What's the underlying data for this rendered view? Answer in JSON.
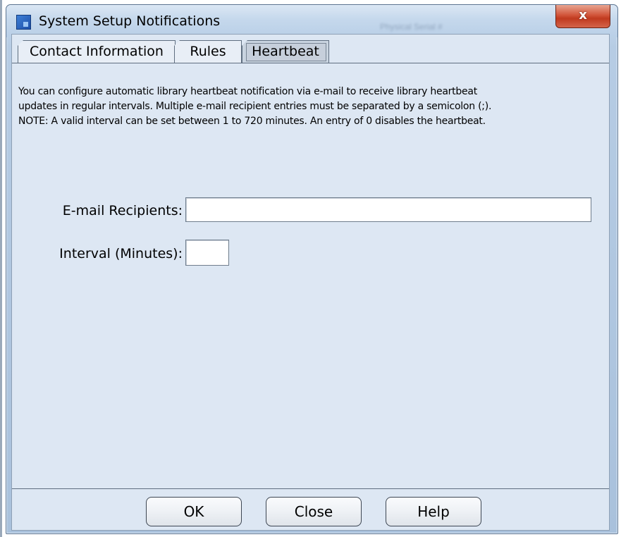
{
  "window": {
    "title": "System Setup Notifications",
    "close_label": "x",
    "background_title_ghost": "Physical Serial #"
  },
  "tabs": [
    {
      "label": "Contact Information",
      "selected": false
    },
    {
      "label": "Rules",
      "selected": false
    },
    {
      "label": "Heartbeat",
      "selected": true
    }
  ],
  "heartbeat": {
    "description_lines": [
      "You can configure automatic library heartbeat notification via e-mail to receive library heartbeat",
      "updates in regular intervals. Multiple e-mail recipient entries must be separated by a semicolon (;).",
      "NOTE: A valid interval can be set between 1 to 720 minutes. An entry of 0 disables the heartbeat."
    ],
    "email_label": "E-mail Recipients:",
    "email_value": "",
    "interval_label": "Interval (Minutes):",
    "interval_value": ""
  },
  "buttons": {
    "ok": "OK",
    "close": "Close",
    "help": "Help"
  },
  "colors": {
    "panel_bg": "#dde7f3",
    "close_button": "#c03a1f",
    "selected_tab": "#c9d4e0"
  },
  "icons": {
    "app": "app-window-icon",
    "close": "close-x-icon"
  }
}
